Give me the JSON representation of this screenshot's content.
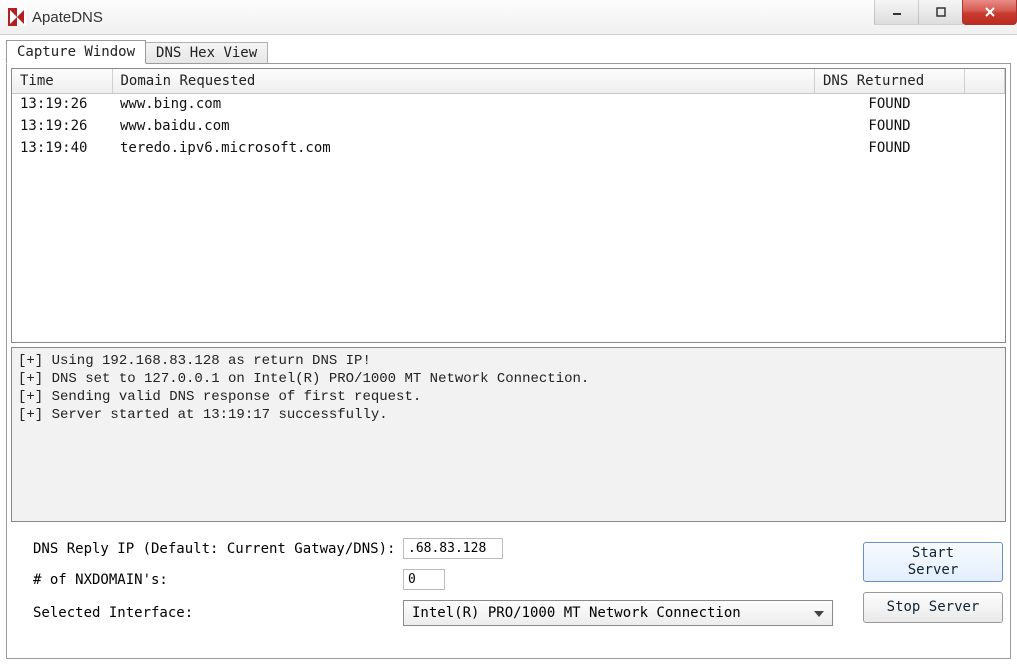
{
  "window": {
    "title": "ApateDNS"
  },
  "tabs": {
    "items": [
      {
        "label": "Capture Window",
        "active": true
      },
      {
        "label": "DNS Hex View",
        "active": false
      }
    ]
  },
  "table": {
    "columns": {
      "time": "Time",
      "domain": "Domain Requested",
      "ret": "DNS Returned"
    },
    "rows": [
      {
        "time": "13:19:26",
        "domain": "www.bing.com",
        "ret": "FOUND"
      },
      {
        "time": "13:19:26",
        "domain": "www.baidu.com",
        "ret": "FOUND"
      },
      {
        "time": "13:19:40",
        "domain": "teredo.ipv6.microsoft.com",
        "ret": "FOUND"
      }
    ]
  },
  "log": {
    "lines": [
      "[+] Using 192.168.83.128 as return DNS IP!",
      "[+] DNS set to 127.0.0.1 on Intel(R) PRO/1000 MT Network Connection.",
      "[+] Sending valid DNS response of first request.",
      "[+] Server started at 13:19:17 successfully."
    ]
  },
  "form": {
    "reply_ip_label": "DNS Reply IP (Default: Current Gatway/DNS):",
    "reply_ip_value": ".68.83.128",
    "nxdomain_label": "# of NXDOMAIN's:",
    "nxdomain_value": "0",
    "iface_label": "Selected Interface:",
    "iface_value": "Intel(R) PRO/1000 MT Network Connection"
  },
  "buttons": {
    "start": "Start\nServer",
    "stop": "Stop Server"
  }
}
